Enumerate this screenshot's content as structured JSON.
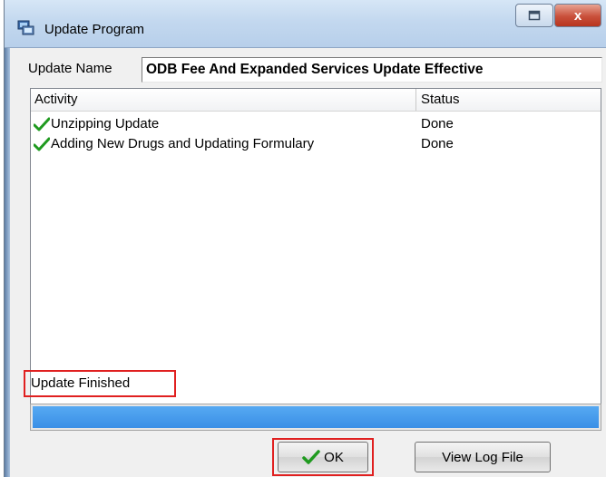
{
  "window": {
    "title": "Update Program",
    "close_glyph": "x"
  },
  "update": {
    "name_label": "Update Name",
    "name_value": "ODB Fee And Expanded Services Update Effective"
  },
  "activity_list": {
    "columns": [
      "Activity",
      "Status"
    ],
    "rows": [
      {
        "activity": "Unzipping Update",
        "status": "Done",
        "icon": "check-icon"
      },
      {
        "activity": "Adding New Drugs and Updating Formulary",
        "status": "Done",
        "icon": "check-icon"
      }
    ]
  },
  "status": {
    "text": "Update Finished"
  },
  "progress": {
    "percent": 100,
    "color": "#3f95ea"
  },
  "buttons": {
    "ok_label": "OK",
    "view_log_label": "View Log File"
  },
  "colors": {
    "highlight_box": "#e02020",
    "check_green": "#1f9a1f"
  }
}
